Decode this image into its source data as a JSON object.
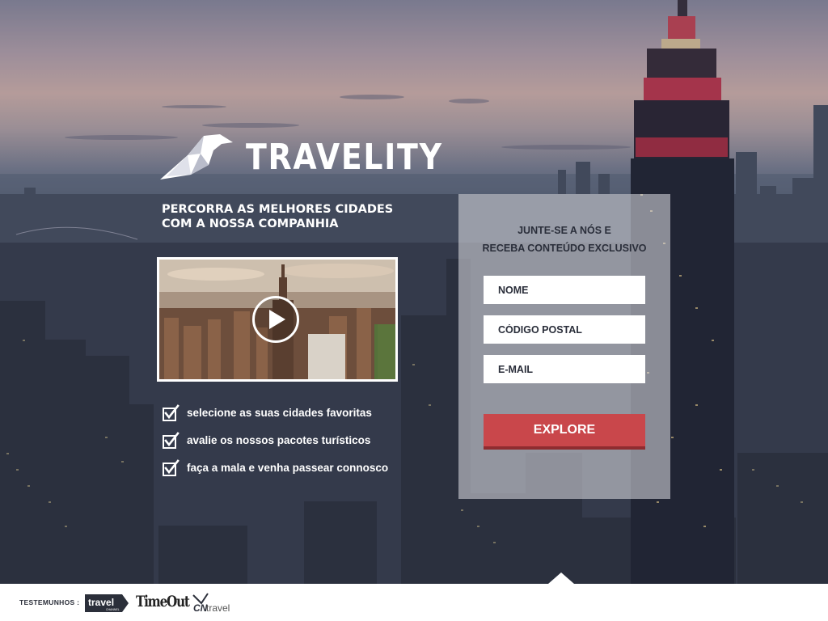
{
  "brand": {
    "name": "TRAVELITY"
  },
  "hero": {
    "headline_line1": "PERCORRA AS MELHORES CIDADES",
    "headline_line2": "COM A NOSSA COMPANHIA"
  },
  "video": {
    "play_icon": "play-icon"
  },
  "features": [
    {
      "icon": "checkbox-checked-icon",
      "label": "selecione as suas cidades favoritas"
    },
    {
      "icon": "checkbox-checked-icon",
      "label": "avalie os nossos pacotes turísticos"
    },
    {
      "icon": "checkbox-checked-icon",
      "label": "faça a mala e venha passear connosco"
    }
  ],
  "signup": {
    "title_line1": "JUNTE-SE A NÓS E",
    "title_line2": "RECEBA CONTEÚDO EXCLUSIVO",
    "name_placeholder": "NOME",
    "postal_placeholder": "CÓDIGO POSTAL",
    "email_placeholder": "E-MAIL",
    "submit_label": "EXPLORE"
  },
  "footer": {
    "testimonials_label": "TESTEMUNHOS :",
    "brands": {
      "travel": "travel",
      "travel_sub": "CHANNEL",
      "timeout": "TimeOut",
      "cn": "CN",
      "cn_travel": "travel"
    }
  },
  "colors": {
    "accent": "#c9474b",
    "accent_dark": "#8f2c30",
    "text_dark": "#2a2e3a"
  }
}
